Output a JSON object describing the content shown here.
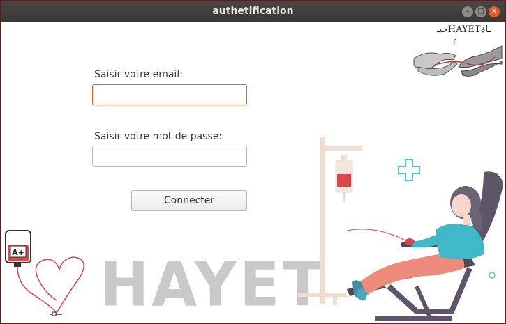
{
  "window": {
    "title": "authetification",
    "controls": {
      "minimize": "–",
      "maximize": "□",
      "close": "✕"
    }
  },
  "form": {
    "email_label": "Saisir votre email:",
    "email_value": "",
    "password_label": "Saisir votre mot de passe:",
    "password_value": "",
    "submit_label": "Connecter"
  },
  "branding": {
    "watermark": "HAYET",
    "logo_text": "حيـHAYETـاة",
    "blood_type": "A+"
  },
  "colors": {
    "focus_border": "#e0632a",
    "blood_red": "#d9474f",
    "chair": "#5e5668",
    "shirt": "#3fb9c7",
    "pants": "#ec8b7c",
    "iv_pole": "#f0ddd0",
    "cross": "#4fc4d0"
  },
  "icons": [
    "hands-icon",
    "blood-bag-icon",
    "heart-tube-icon",
    "iv-stand-icon",
    "medical-cross-icon",
    "donor-chair-icon"
  ]
}
